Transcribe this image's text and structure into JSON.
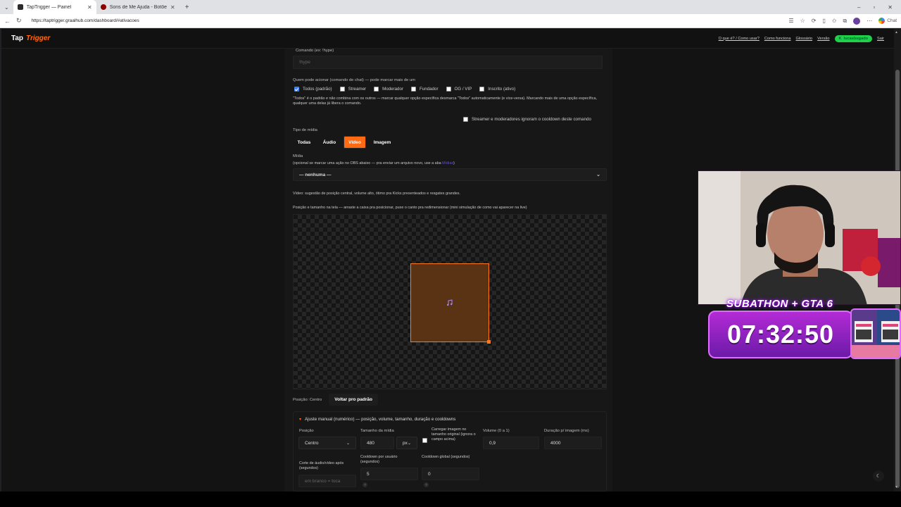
{
  "browser": {
    "tabs": [
      {
        "title": "TapTrigger — Painel",
        "favicon_color": "#2b2b2b",
        "active": true
      },
      {
        "title": "Sons de Me Ajuda - Botões sonor",
        "favicon_color": "#8b0000",
        "active": false
      }
    ],
    "url": "https://taptrigger.graalhub.com/dashboard/#ativacoes",
    "chat_label": "Chat"
  },
  "header": {
    "brand_primary": "Tap",
    "brand_accent": "Trigger",
    "nav": [
      {
        "label": "O que é? / Como usar?"
      },
      {
        "label": "Como funciona"
      },
      {
        "label": "Glossário"
      },
      {
        "label": "Versão"
      }
    ],
    "user": "lucasbugado",
    "logout": "Sair",
    "accent_color": "#ff6a13",
    "user_badge_color": "#1fd14a"
  },
  "form": {
    "command_label": "Comando (ex: !hype)",
    "command_placeholder": "!hype",
    "who_label": "Quem pode acionar (comando de chat) — pode marcar mais de um",
    "roles": [
      {
        "label": "Todos (padrão)",
        "checked": true
      },
      {
        "label": "Streamer",
        "checked": false
      },
      {
        "label": "Moderador",
        "checked": false
      },
      {
        "label": "Fundador",
        "checked": false
      },
      {
        "label": "OG / VIP",
        "checked": false
      },
      {
        "label": "Inscrito (ativo)",
        "checked": false
      }
    ],
    "roles_note": "\"Todos\" é o padrão e não combina com os outros — marcar qualquer opção específica desmarca \"Todos\" automaticamente (e vice-versa). Marcando mais de uma opção específica, qualquer uma delas já libera o comando.",
    "cooldown_ignore_label": "Streamer e moderadores ignoram o cooldown deste comando",
    "media_type_label": "Tipo de mídia",
    "media_types": [
      {
        "label": "Todas",
        "selected": false
      },
      {
        "label": "Áudio",
        "selected": false
      },
      {
        "label": "Vídeo",
        "selected": true
      },
      {
        "label": "Imagem",
        "selected": false
      }
    ],
    "media_label": "Mídia",
    "media_hint": "(opcional se marcar uma ação no OBS abaixo — pra enviar um arquivo novo, use a aba",
    "media_hint_link": "Mídias",
    "media_hint_end": ")",
    "media_select_value": "— nenhuma —",
    "video_hint": "Vídeo: sugestão de posição central, volume alto, ótimo pra Kicks presenteados e resgates grandes.",
    "canvas_label": "Posição e tamanho na tela — arraste a caixa pra posicionar, puxe o canto pra redimensionar (mini simulação de como vai aparecer na live)",
    "position_text": "Posição: Centro",
    "reset_button": "Voltar pro padrão",
    "manual_title": "Ajuste manual (numérico) — posição, volume, tamanho, duração e cooldowns",
    "fields": {
      "position_label": "Posição",
      "position_value": "Centro",
      "size_label": "Tamanho da mídia",
      "size_value": "480",
      "size_unit": "px",
      "original_size_label": "Carregar imagem no tamanho original (ignora o campo acima)",
      "volume_label": "Volume (0 a 1)",
      "volume_value": "0,9",
      "duration_label": "Duração p/ imagem (ms)",
      "duration_value": "4000",
      "cut_label": "Corte de áudio/vídeo após (segundos)",
      "cut_placeholder": "em branco = toca",
      "user_cooldown_label": "Cooldown por usuário (segundos)",
      "user_cooldown_value": "5",
      "global_cooldown_label": "Cooldown global (segundos)",
      "global_cooldown_value": "0",
      "help": "?"
    }
  },
  "overlay": {
    "subathon_title": "SUBATHON + GTA 6",
    "timer": "07:32:50"
  }
}
